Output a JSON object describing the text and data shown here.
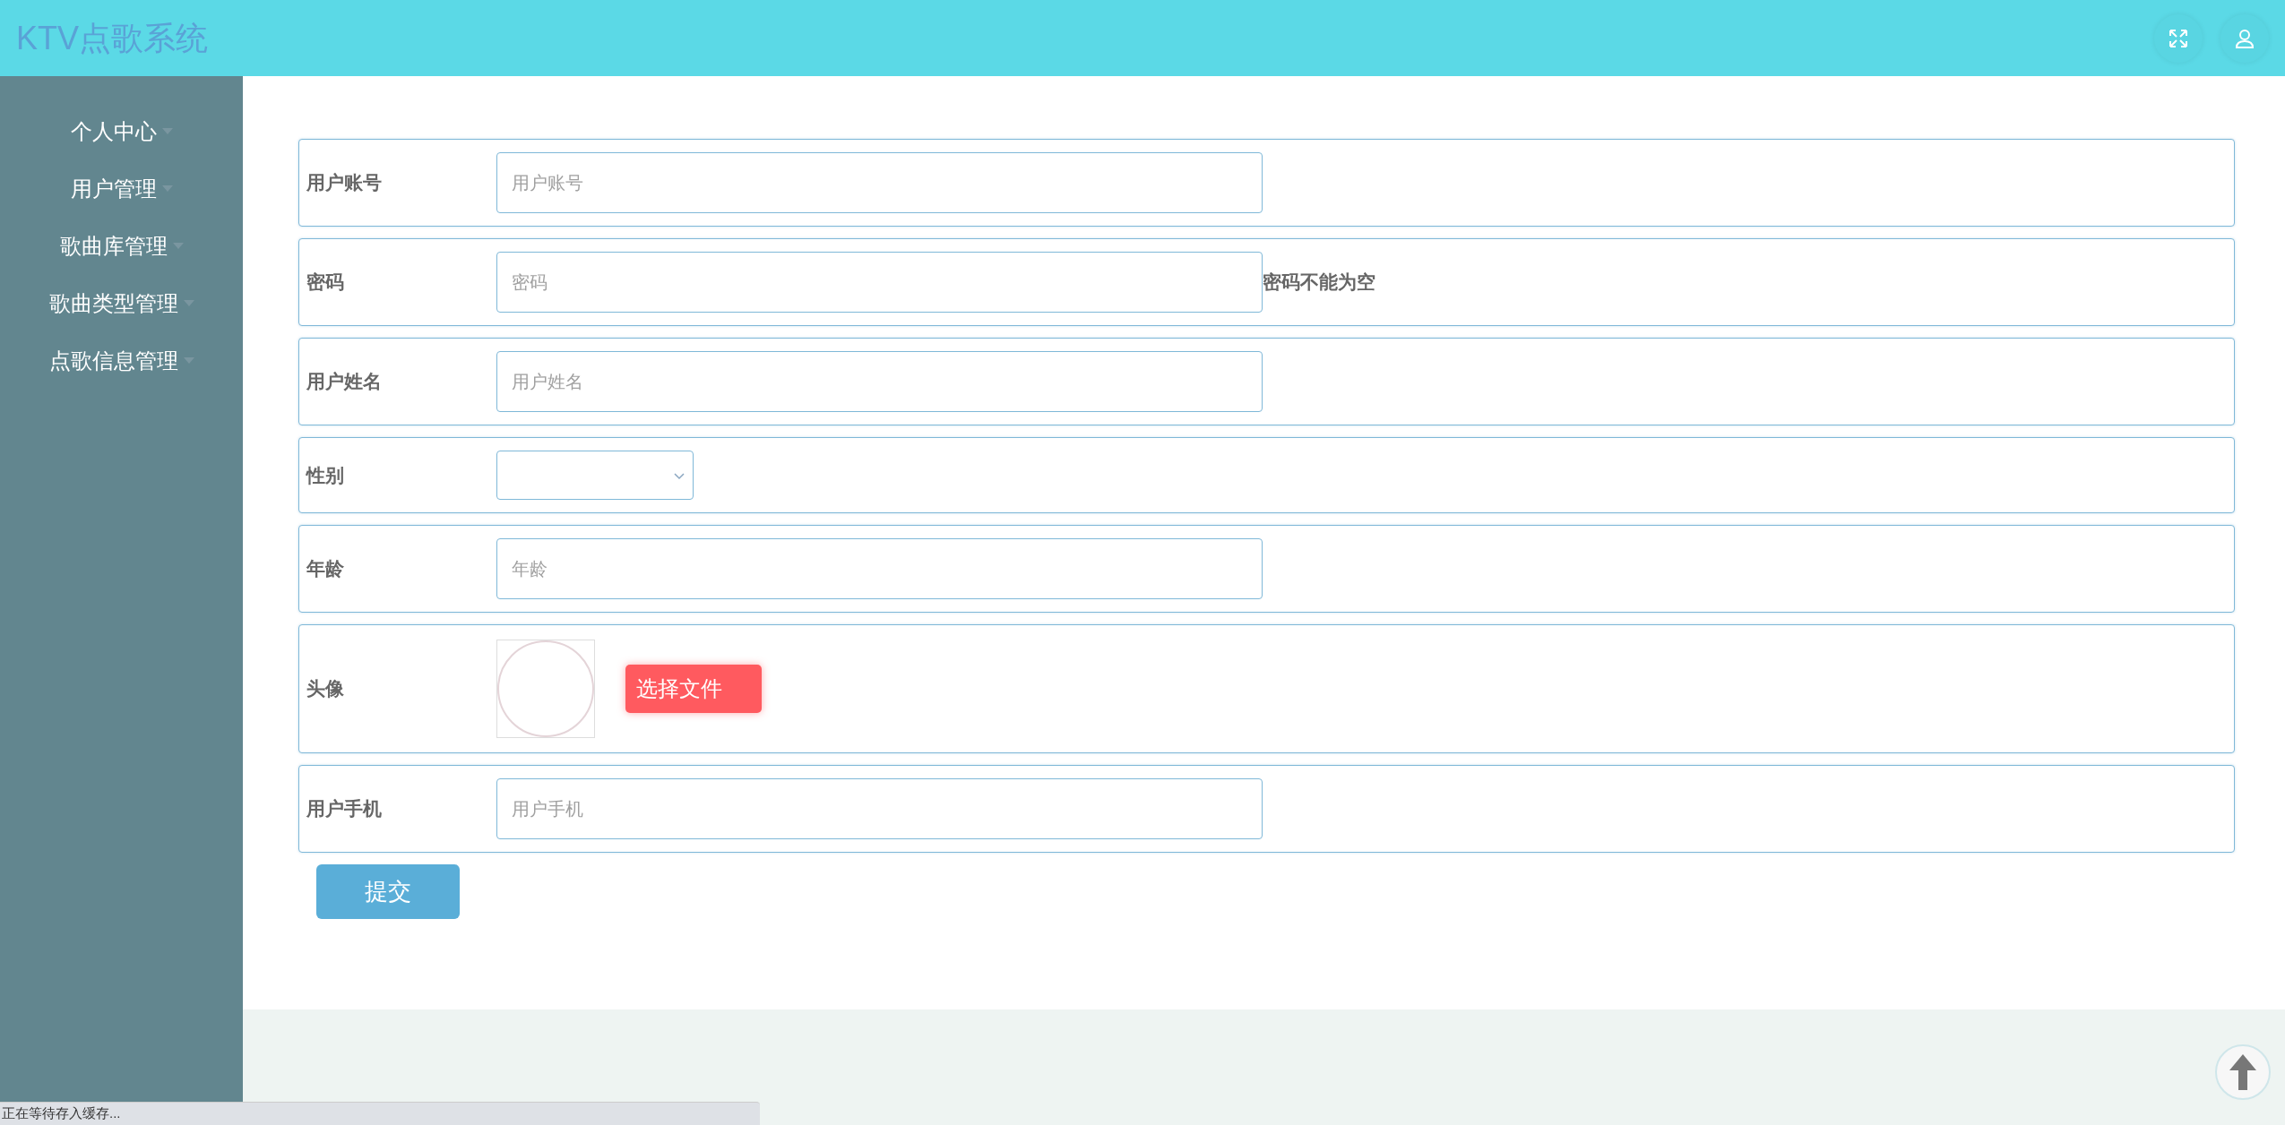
{
  "header": {
    "title": "KTV点歌系统"
  },
  "sidebar": {
    "items": [
      {
        "label": "个人中心"
      },
      {
        "label": "用户管理"
      },
      {
        "label": "歌曲库管理"
      },
      {
        "label": "歌曲类型管理"
      },
      {
        "label": "点歌信息管理"
      }
    ]
  },
  "form": {
    "fields": [
      {
        "kind": "text",
        "label": "用户账号",
        "placeholder": "用户账号"
      },
      {
        "kind": "text",
        "label": "密码",
        "placeholder": "密码",
        "error": "密码不能为空"
      },
      {
        "kind": "text",
        "label": "用户姓名",
        "placeholder": "用户姓名"
      },
      {
        "kind": "select",
        "label": "性别"
      },
      {
        "kind": "text",
        "label": "年龄",
        "placeholder": "年龄"
      },
      {
        "kind": "image",
        "label": "头像",
        "button": "选择文件"
      },
      {
        "kind": "text",
        "label": "用户手机",
        "placeholder": "用户手机"
      }
    ],
    "submit": "提交"
  },
  "status_bar": {
    "text": "正在等待存入缓存..."
  }
}
